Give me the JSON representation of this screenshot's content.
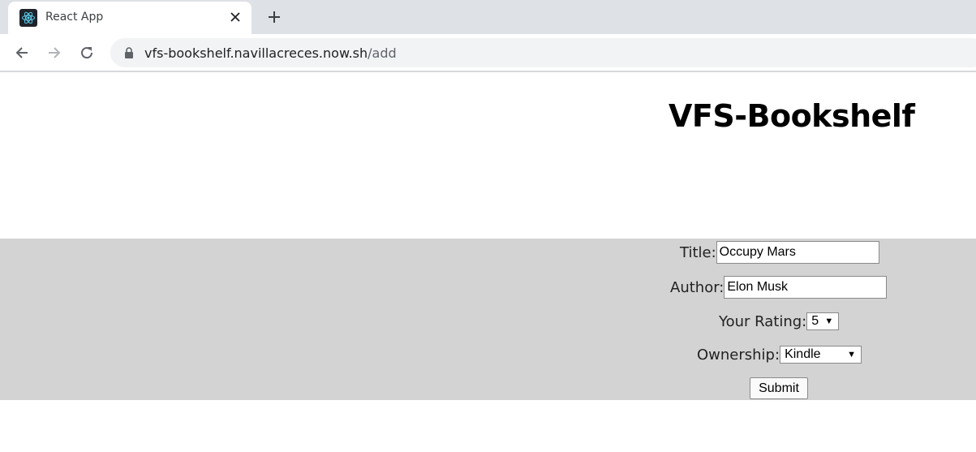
{
  "browser": {
    "tab_title": "React App",
    "url_host": "vfs-bookshelf.navillacreces.now.sh",
    "url_path": "/add"
  },
  "page": {
    "title": "VFS-Bookshelf"
  },
  "form": {
    "title_label": "Title:",
    "title_value": "Occupy Mars",
    "author_label": "Author:",
    "author_value": "Elon Musk",
    "rating_label": "Your Rating:",
    "rating_value": "5",
    "ownership_label": "Ownership:",
    "ownership_value": "Kindle",
    "submit_label": "Submit"
  },
  "colors": {
    "form_background": "#d3d3d3",
    "tabstrip": "#dee1e6"
  }
}
